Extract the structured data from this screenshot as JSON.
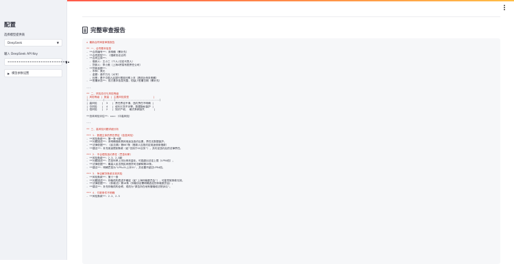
{
  "sidebar": {
    "title": "配置",
    "model_label": "选择模型提供商",
    "model_value": "DeepSeek",
    "api_label": "输入 DeepSeek API Key",
    "api_value": "••••••••••••••••••••••••••••••••",
    "advanced_label": "模型参数设置"
  },
  "main": {
    "title": "完整审查报告"
  },
  "report": {
    "lines": [
      {
        "t": "★ 最新合同审查审核报告",
        "c": "red"
      },
      {
        "t": "",
        "c": "gap"
      },
      {
        "t": "** 一、合同基本信息",
        "c": "red"
      },
      {
        "t": "- **合同编号**：未明确（需补充）",
        "c": ""
      },
      {
        "t": "- **合同类型**：《借款协议合同",
        "c": ""
      },
      {
        "t": "- **合同主体**：",
        "c": ""
      },
      {
        "t": "  - 借款人：王小三（个人/法定代表人）",
        "c": ""
      },
      {
        "t": "  - 贷款人：李小美（上海X贸易有限责任公司）",
        "c": ""
      },
      {
        "t": "- **贷款金额**：",
        "c": ""
      },
      {
        "t": "  - 币种：美元",
        "c": ""
      },
      {
        "t": "  - 金额：叁仟万元（大写）",
        "c": ""
      },
      {
        "t": "  - 利率：基于中国人民银行基准利率上浮（具体比例未明确）",
        "c": ""
      },
      {
        "t": "- **签署状态**：双方基本信息完整，但缺少签署日期（需补充）",
        "c": ""
      },
      {
        "t": "",
        "c": "gap"
      },
      {
        "t": "---",
        "c": ""
      },
      {
        "t": "",
        "c": "gap"
      },
      {
        "t": "** 二、风险总评与风险等级",
        "c": "red"
      },
      {
        "t": "| 风险等级 | 数量 | 主要风险类型                |",
        "c": "red"
      },
      {
        "t": "|----------|------|-----------------------------|",
        "c": ""
      },
      {
        "t": "| 高风险   |  3   | 责任界定不清、违约责任不明确 |",
        "c": ""
      },
      {
        "t": "| 中风险   |  4   | 权利义务不对等，数据隐私保护 |",
        "c": ""
      },
      {
        "t": "| 低风险   |  2   | 知识产权、 格式条款缺失      |",
        "c": ""
      },
      {
        "t": "",
        "c": "gap"
      },
      {
        "t": "**总体风险评估**：★★★☆（中高风险）",
        "c": ""
      },
      {
        "t": "",
        "c": "gap"
      },
      {
        "t": "---",
        "c": ""
      },
      {
        "t": "",
        "c": "gap"
      },
      {
        "t": "** 三、高风险问题详细分析",
        "c": "red"
      },
      {
        "t": "",
        "c": "gap"
      },
      {
        "t": "*** 1. 数据主体的责任界定（信息风险）",
        "c": "red"
      },
      {
        "t": "- **风险条款**：第一条~6款",
        "c": ""
      },
      {
        "t": "- **问题描述**：未明确借款具体用途及违约后果，责任无数据保护。",
        "c": ""
      },
      {
        "t": "- **法律依据**：《民法典》第667条（借款人应按约定用途使用借款）",
        "c": ""
      },
      {
        "t": "- **建议**：补充用途限制条款（如\"仅用于XX业务\"），并约定违约后的法律责任。",
        "c": ""
      },
      {
        "t": "",
        "c": "gap"
      },
      {
        "t": "*** 2. 不合理的违约责任（罚息利率）",
        "c": "red"
      },
      {
        "t": "- **风险条款**：2.3、2.8款",
        "c": ""
      },
      {
        "t": "- **问题描述**：罚息利率上浮比例未量化，可能超出法定上限（LPR4倍）。",
        "c": ""
      },
      {
        "t": "- **法律依据**：最高人民法院民间借贷司法解释第28条。",
        "c": ""
      },
      {
        "t": "- **建议**：明确罚息为\"LPR+X%上浮X%\"，并设置不超过LPR4倍。",
        "c": ""
      },
      {
        "t": "",
        "c": "gap"
      },
      {
        "t": "*** 3. 争议解决条款无效风险",
        "c": "red"
      },
      {
        "t": "- **风险条款**：第十一条",
        "c": ""
      },
      {
        "t": "- **问题描述**：仲裁机构表述不确定（如\"上海仲裁委员会\"），可能导致条款无效。",
        "c": ""
      },
      {
        "t": "- **法律依据**：《仲裁法》第16条（仲裁协议需明确选定的仲裁委员会）。",
        "c": ""
      },
      {
        "t": "- **建议**：补充仲裁机构全称，或改为\"原告所在地有管辖权法院诉讼\"。",
        "c": ""
      },
      {
        "t": "",
        "c": "gap"
      },
      {
        "t": "*** 4. 付款条件不明确",
        "c": "red"
      },
      {
        "t": "- **风险条款**：2.2、2.3",
        "c": ""
      }
    ]
  }
}
